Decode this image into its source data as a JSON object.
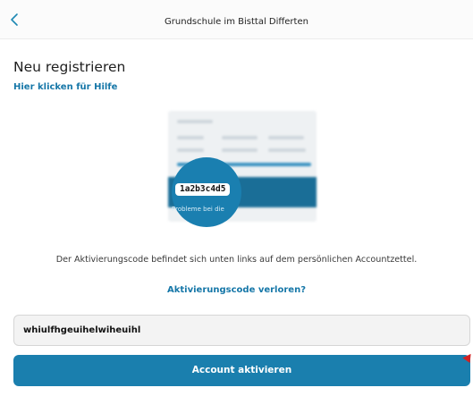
{
  "header": {
    "back_icon": "chevron-left-icon",
    "title": "Grundschule im Bisttal  Differten"
  },
  "main": {
    "title": "Neu registrieren",
    "help_link": "Hier klicken für Hilfe",
    "illustration": {
      "code_sample": "1a2b3c4d5",
      "caption": "Probleme bei die"
    },
    "description": "Der Aktivierungscode befindet sich unten links auf dem persönlichen Accountzettel.",
    "lost_code_link": "Aktivierungscode verloren?",
    "code_input": {
      "value": "whiulfhgeuihelwiheuihl",
      "placeholder": ""
    },
    "activate_button": "Account aktivieren"
  },
  "colors": {
    "accent": "#1a7fae",
    "link": "#1677a8"
  }
}
